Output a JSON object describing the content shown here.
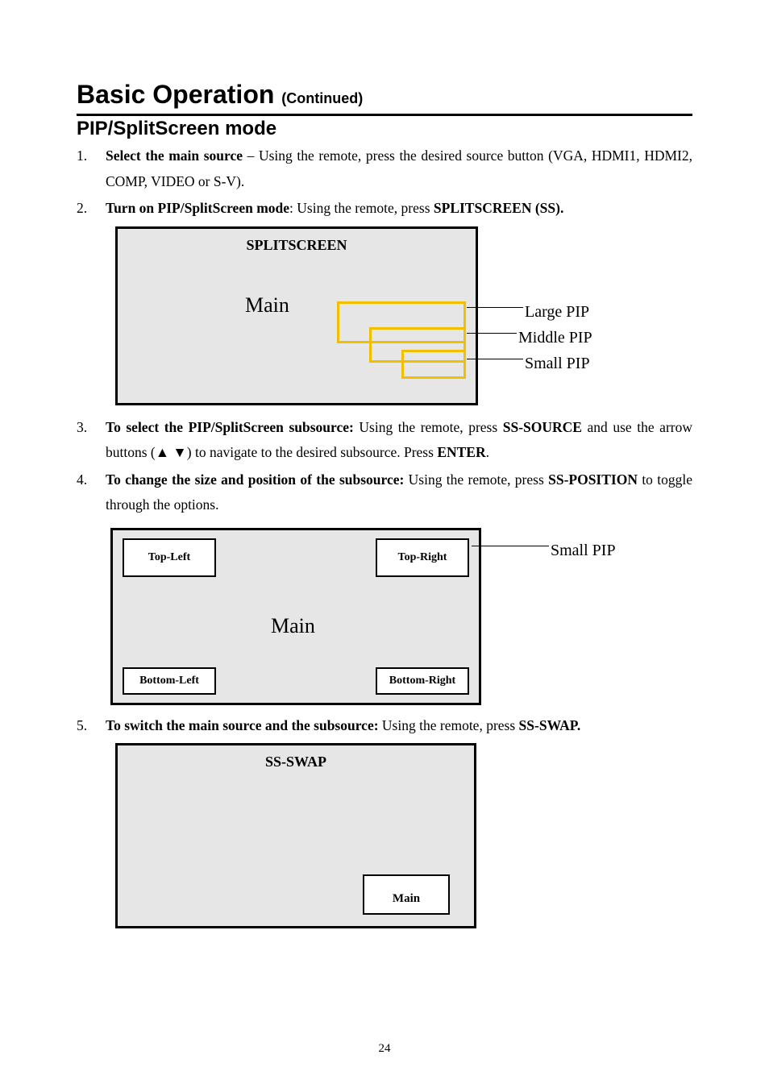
{
  "heading": {
    "title": "Basic Operation ",
    "continued": "(Continued)"
  },
  "section_title": "PIP/SplitScreen mode",
  "steps": {
    "s1_bold": "Select the main source",
    "s1_rest": " – Using the remote, press the desired source button (VGA, HDMI1, HDMI2, COMP, VIDEO or S-V).",
    "s2_bold": "Turn on PIP/SplitScreen mode",
    "s2_rest1": ": Using the remote, press ",
    "s2_bold2": "SPLITSCREEN (SS).",
    "s3_bold": "To select the PIP/SplitScreen subsource:",
    "s3_rest1": " Using the remote, press ",
    "s3_bold2": "SS-SOURCE",
    "s3_rest2": " and use the arrow buttons (▲ ▼) to navigate to the desired subsource. Press ",
    "s3_bold3": "ENTER",
    "s3_rest3": ".",
    "s4_bold": "To change the size and position of the subsource:",
    "s4_rest1": " Using the remote, press ",
    "s4_bold2": "SS-POSITION",
    "s4_rest2": " to toggle through the options.",
    "s5_bold": "To switch the main source and the subsource:",
    "s5_rest1": " Using the remote, press ",
    "s5_bold2": "SS-SWAP."
  },
  "diagram1": {
    "title": "SPLITSCREEN",
    "main": "Main",
    "labels": {
      "large": "Large PIP",
      "middle": "Middle PIP",
      "small": "Small PIP"
    }
  },
  "diagram2": {
    "tl": "Top-Left",
    "tr": "Top-Right",
    "bl": "Bottom-Left",
    "br": "Bottom-Right",
    "main": "Main",
    "callout": "Small PIP"
  },
  "diagram3": {
    "title": "SS-SWAP",
    "main": "Main"
  },
  "page_number": "24"
}
